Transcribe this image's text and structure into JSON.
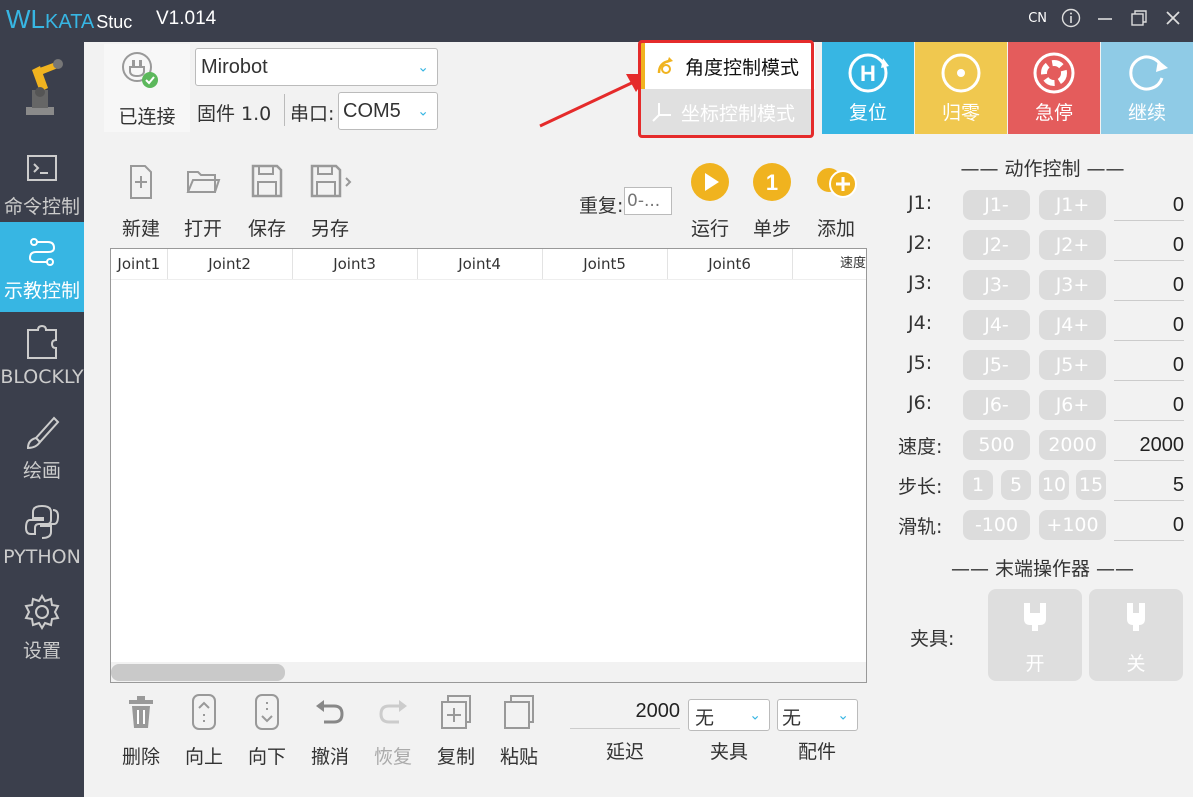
{
  "titlebar": {
    "logo_wl": "WL",
    "logo_kata": "KATA",
    "logo_stu": "Stuc",
    "version": "V1.014",
    "lang": "CN"
  },
  "sidebar": {
    "items": [
      {
        "label": ""
      },
      {
        "label": "命令控制"
      },
      {
        "label": "示教控制"
      },
      {
        "label": "BLOCKLY"
      },
      {
        "label": "绘画"
      },
      {
        "label": "PYTHON"
      },
      {
        "label": "设置"
      }
    ]
  },
  "header": {
    "connection_status": "已连接",
    "device": "Mirobot",
    "firmware": "固件 1.0",
    "port_label": "串口:",
    "port": "COM5",
    "mode_angle": "角度控制模式",
    "mode_coord": "坐标控制模式",
    "buttons": [
      {
        "label": "复位",
        "color": "#37b6e3"
      },
      {
        "label": "归零",
        "color": "#f0c84f"
      },
      {
        "label": "急停",
        "color": "#e45c5c"
      },
      {
        "label": "继续",
        "color": "#8fcbe6"
      }
    ]
  },
  "toolbar": {
    "new": "新建",
    "open": "打开",
    "save": "保存",
    "save_as": "另存",
    "repeat_label": "重复:",
    "repeat_placeholder": "0-...",
    "run": "运行",
    "step": "单步",
    "add": "添加"
  },
  "table": {
    "columns": [
      "Joint1",
      "Joint2",
      "Joint3",
      "Joint4",
      "Joint5",
      "Joint6",
      "速度"
    ]
  },
  "bottom": {
    "delete": "删除",
    "up": "向上",
    "down": "向下",
    "undo": "撤消",
    "redo": "恢复",
    "copy": "复制",
    "paste": "粘贴",
    "delay_value": "2000",
    "delay_label": "延迟",
    "gripper_value": "无",
    "gripper_label": "夹具",
    "accessory_value": "无",
    "accessory_label": "配件"
  },
  "control": {
    "title": "—— 动作控制 ——",
    "joints": [
      {
        "label": "J1:",
        "minus": "J1-",
        "plus": "J1+",
        "value": "0"
      },
      {
        "label": "J2:",
        "minus": "J2-",
        "plus": "J2+",
        "value": "0"
      },
      {
        "label": "J3:",
        "minus": "J3-",
        "plus": "J3+",
        "value": "0"
      },
      {
        "label": "J4:",
        "minus": "J4-",
        "plus": "J4+",
        "value": "0"
      },
      {
        "label": "J5:",
        "minus": "J5-",
        "plus": "J5+",
        "value": "0"
      },
      {
        "label": "J6:",
        "minus": "J6-",
        "plus": "J6+",
        "value": "0"
      }
    ],
    "speed": {
      "label": "速度:",
      "opt1": "500",
      "opt2": "2000",
      "value": "2000"
    },
    "step": {
      "label": "步长:",
      "opts": [
        "1",
        "5",
        "10",
        "15"
      ],
      "value": "5"
    },
    "rail": {
      "label": "滑轨:",
      "minus": "-100",
      "plus": "+100",
      "value": "0"
    },
    "end_title": "—— 末端操作器 ——",
    "gripper_label": "夹具:",
    "open": "开",
    "close": "关"
  },
  "colors": {
    "accent": "#37b6e3",
    "sidebar": "#3b3f4c",
    "highlight": "#e52b2b"
  }
}
